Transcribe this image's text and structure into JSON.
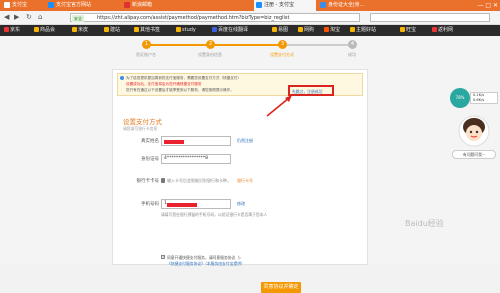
{
  "browser": {
    "tabs": [
      {
        "label": "支付宝"
      },
      {
        "label": "支付宝官方网站"
      },
      {
        "label": "新浪邮箱"
      },
      {
        "label": "注册 - 支付宝"
      },
      {
        "label": "身份证大全|身…"
      }
    ],
    "url": "https://zht.alipay.com/assist/paymethod/paymethod.htm?bizType=biz_reglist",
    "secure_label": "安全",
    "window_controls": "— □ ✕"
  },
  "bookmarks": [
    "京东",
    "商品会",
    "米皮",
    "建站",
    "其他书签",
    "study",
    "百度在线翻译",
    "易图",
    "网购",
    "淘宝",
    "主题好站",
    "旺宝",
    "返利网"
  ],
  "steps": [
    {
      "num": "1",
      "label": "验证账户名"
    },
    {
      "num": "2",
      "label": "设置身份信息"
    },
    {
      "num": "3",
      "label": "设置支付方式"
    },
    {
      "num": "4",
      "label": "成功"
    }
  ],
  "notice": {
    "line1": "为了给您提供更加周到的支付宝服务，需要您设置支付方式（快捷支付）",
    "line2": "设置成功后，支付宝将会为您开通快捷支付服务",
    "line3": "您只有在通过以下设置后才能享受到以下服务，请您按照提示操作。",
    "skip_link": "先跳过，注册成功"
  },
  "form": {
    "title": "设置支付方式",
    "subtitle": "请您填写银行卡信息",
    "name_label": "真实姓名",
    "name_hint": "仍然注册",
    "id_label": "身份证号",
    "id_value": "4*****************8",
    "card_label": "银行卡卡号",
    "card_sub": "输入卡号后会智能识别银行和卡种。",
    "card_hint": "银行卡号",
    "phone_label": "手机号码",
    "phone_value": "1",
    "phone_sub": "请填写您在银行预留的手机号码，以验证银行卡是否属于您本人",
    "phone_hint": "修改",
    "agree_text": "同意开通快捷支付服务，请同意服务协议（)",
    "agree_sub": "《快捷支付服务协议》（本服务由支付宝提供）",
    "submit_label": "同意协议并确定"
  },
  "widgets": {
    "weather_temp": "78%",
    "weather_line1": "0.1K/s",
    "weather_line2": "0.6K/s",
    "help_text": "有问题问我~",
    "watermark": "Baidu经验"
  }
}
